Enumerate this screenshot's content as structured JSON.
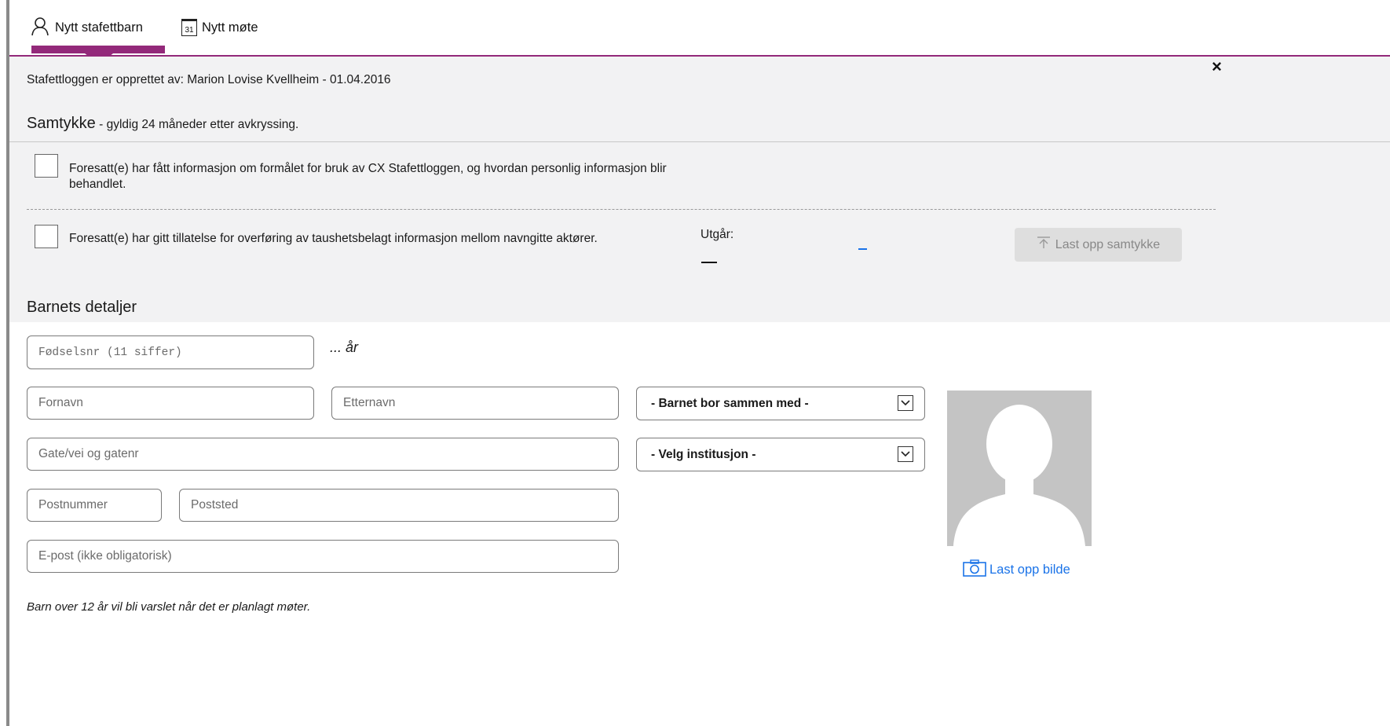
{
  "tabs": [
    {
      "label": "Nytt stafettbarn",
      "icon": "person-icon",
      "active": true
    },
    {
      "label": "Nytt møte",
      "icon": "calendar-icon",
      "calendar_day": "31"
    }
  ],
  "close_symbol": "×",
  "created_text": "Stafettloggen er opprettet av: Marion Lovise Kvellheim - 01.04.2016",
  "consent": {
    "title": "Samtykke",
    "subtitle": " - gyldig 24 måneder etter avkryssing.",
    "items": [
      {
        "text": "Foresatt(e) har fått informasjon om formålet for bruk av CX Stafettloggen, og hvordan personlig informasjon blir behandlet."
      },
      {
        "text": "Foresatt(e) har gitt tillatelse for overføring av taushetsbelagt informasjon mellom navngitte aktører."
      }
    ],
    "expires_label": "Utgår:",
    "upload_label": "Last opp samtykke"
  },
  "child": {
    "title": "Barnets detaljer",
    "ssn_placeholder": "Fødselsnr (11 siffer)",
    "age_text": "... år",
    "firstname_placeholder": "Fornavn",
    "lastname_placeholder": "Etternavn",
    "lives_with_select": "- Barnet bor sammen med -",
    "street_placeholder": "Gate/vei og gatenr",
    "institution_select": "- Velg institusjon -",
    "postcode_placeholder": "Postnummer",
    "city_placeholder": "Poststed",
    "email_placeholder": "E-post (ikke obligatorisk)",
    "upload_photo_label": "Last opp bilde",
    "note": "Barn over 12 år vil bli varslet når det er planlagt møter."
  },
  "colors": {
    "accent": "#93297a",
    "link": "#1a73e8",
    "panel_bg": "#f2f2f3"
  }
}
